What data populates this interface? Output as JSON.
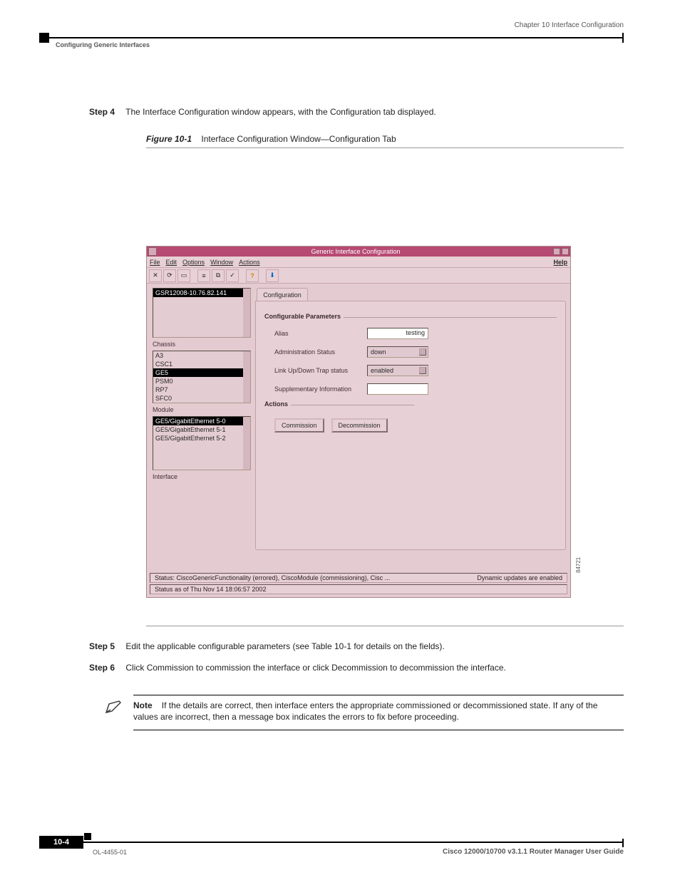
{
  "header": {
    "chapter": "Chapter 10      Interface Configuration",
    "section": "Configuring Generic Interfaces"
  },
  "step4": {
    "label": "Step 4",
    "text": "The Interface Configuration window appears, with the Configuration tab displayed."
  },
  "figure": {
    "id": "Figure 10-1",
    "title": "Interface Configuration Window—Configuration Tab",
    "side_id": "84721"
  },
  "window": {
    "title": "Generic Interface Configuration",
    "menu": {
      "file": "File",
      "edit": "Edit",
      "options": "Options",
      "window": "Window",
      "actions": "Actions",
      "help": "Help"
    },
    "left": {
      "device": "GSR12008-10.76.82.141",
      "chassis_label": "Chassis",
      "modules": [
        "A3",
        "CSC1",
        "GE5",
        "PSM0",
        "RP7",
        "SFC0"
      ],
      "module_selected_index": 2,
      "module_label": "Module",
      "interfaces": [
        "GE5/GigabitEthernet 5-0",
        "GE5/GigabitEthernet 5-1",
        "GE5/GigabitEthernet 5-2"
      ],
      "iface_selected_index": 0,
      "interface_label": "Interface"
    },
    "tab": "Configuration",
    "params_legend": "Configurable Parameters",
    "params": {
      "alias_label": "Alias",
      "alias_value": "testing",
      "admin_label": "Administration Status",
      "admin_value": "down",
      "trap_label": "Link Up/Down Trap status",
      "trap_value": "enabled",
      "supp_label": "Supplementary Information",
      "supp_value": ""
    },
    "actions_legend": "Actions",
    "actions": {
      "commission": "Commission",
      "decommission": "Decommission"
    },
    "status": {
      "line1_left": "Status: CiscoGenericFunctionality (errored), CiscoModule (commissioning), Cisc ...",
      "line1_right": "Dynamic updates are enabled",
      "line2": "Status as of Thu Nov 14 18:06:57 2002"
    }
  },
  "step5": {
    "label": "Step 5",
    "text": "Edit the applicable configurable parameters (see Table 10-1 for details on the fields)."
  },
  "step6": {
    "label": "Step 6",
    "text": "Click Commission to commission the interface or click Decommission to decommission the interface."
  },
  "note": {
    "label": "Note",
    "text": "If the details are correct, then interface enters the appropriate commissioned or decommissioned state. If any of the values are incorrect, then a message box indicates the errors to fix before proceeding."
  },
  "footer": {
    "page": "10-4",
    "title": "Cisco 12000/10700 v3.1.1 Router Manager User Guide",
    "ol": "OL-4455-01"
  }
}
